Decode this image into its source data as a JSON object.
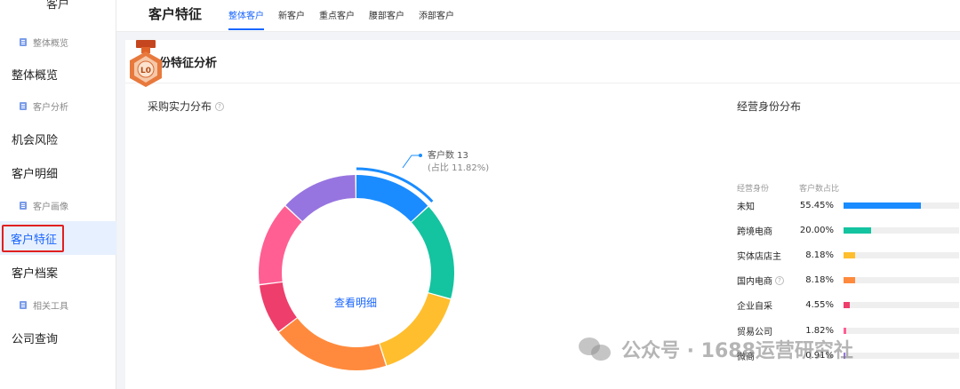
{
  "sidebar": {
    "top_label": "客户",
    "items": [
      {
        "label": "整体概览",
        "kind": "sub"
      },
      {
        "label": "整体概览",
        "kind": "main"
      },
      {
        "label": "客户分析",
        "kind": "sub"
      },
      {
        "label": "机会风险",
        "kind": "main"
      },
      {
        "label": "客户明细",
        "kind": "main"
      },
      {
        "label": "客户画像",
        "kind": "sub"
      },
      {
        "label": "客户特征",
        "kind": "main",
        "active": true
      },
      {
        "label": "客户档案",
        "kind": "main"
      },
      {
        "label": "相关工具",
        "kind": "sub"
      },
      {
        "label": "公司查询",
        "kind": "main"
      }
    ]
  },
  "header": {
    "title": "客户特征",
    "tabs": [
      {
        "label": "整体客户",
        "active": true
      },
      {
        "label": "新客户"
      },
      {
        "label": "重点客户"
      },
      {
        "label": "腰部客户"
      },
      {
        "label": "添部客户"
      }
    ]
  },
  "card": {
    "title": "身份特征分析",
    "left_section": "采购实力分布",
    "right_section": "经营身份分布"
  },
  "donut": {
    "tooltip_count": "客户数 13",
    "tooltip_pct": "(占比 11.82%)",
    "center_badge": "L0",
    "view_details": "查看明细",
    "segments": [
      {
        "color": "#1a8cff",
        "value": 11.82
      },
      {
        "color": "#14c3a0",
        "value": 14.5
      },
      {
        "color": "#ffbe2e",
        "value": 14.0
      },
      {
        "color": "#ff8a3d",
        "value": 17.5
      },
      {
        "color": "#ee3e6b",
        "value": 7.5
      },
      {
        "color": "#ff5f93",
        "value": 12.5
      },
      {
        "color": "#9775e0",
        "value": 11.5
      }
    ],
    "colors": {
      "accent": "#1a66ff"
    }
  },
  "bars": {
    "header_name": "经营身份",
    "header_value": "客户数占比",
    "rows": [
      {
        "name": "未知",
        "pct": "55.45%",
        "value": 55.45,
        "color": "#1a8cff"
      },
      {
        "name": "跨境电商",
        "pct": "20.00%",
        "value": 20.0,
        "color": "#14c3a0"
      },
      {
        "name": "实体店店主",
        "pct": "8.18%",
        "value": 8.18,
        "color": "#ffbe2e"
      },
      {
        "name": "国内电商",
        "pct": "8.18%",
        "value": 8.18,
        "color": "#ff8a3d",
        "help": true
      },
      {
        "name": "企业自采",
        "pct": "4.55%",
        "value": 4.55,
        "color": "#ee3e6b"
      },
      {
        "name": "贸易公司",
        "pct": "1.82%",
        "value": 1.82,
        "color": "#ff5f93"
      },
      {
        "name": "微商",
        "pct": "0.91%",
        "value": 0.91,
        "color": "#9775e0"
      }
    ]
  },
  "watermark": "公众号 · 1688运营研究社"
}
